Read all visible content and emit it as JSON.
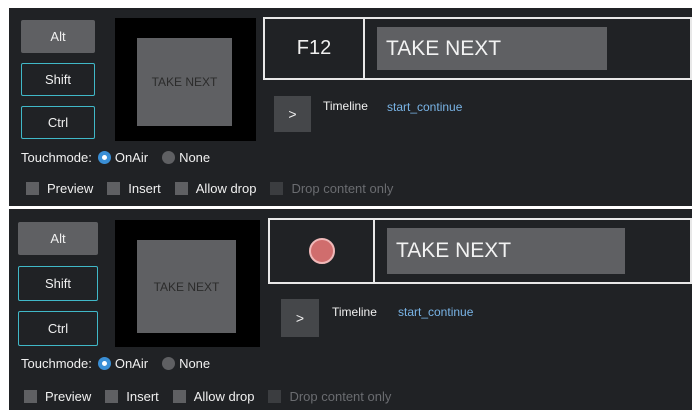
{
  "panels": [
    {
      "modifiers": {
        "alt": "Alt",
        "shift": "Shift",
        "ctrl": "Ctrl"
      },
      "thumbnail_label": "TAKE NEXT",
      "key_label": "F12",
      "button_text": "TAKE NEXT",
      "go_button": ">",
      "timeline_label": "Timeline",
      "timeline_value": "start_continue",
      "touchmode_label": "Touchmode:",
      "touchmode_options": [
        "OnAir",
        "None"
      ],
      "touchmode_selected": "OnAir",
      "checkboxes": [
        "Preview",
        "Insert",
        "Allow drop",
        "Drop content only"
      ]
    },
    {
      "modifiers": {
        "alt": "Alt",
        "shift": "Shift",
        "ctrl": "Ctrl"
      },
      "thumbnail_label": "TAKE NEXT",
      "key_icon": "record-dot-icon",
      "button_text": "TAKE NEXT",
      "go_button": ">",
      "timeline_label": "Timeline",
      "timeline_value": "start_continue",
      "touchmode_label": "Touchmode:",
      "touchmode_options": [
        "OnAir",
        "None"
      ],
      "touchmode_selected": "OnAir",
      "checkboxes": [
        "Preview",
        "Insert",
        "Allow drop",
        "Drop content only"
      ]
    }
  ],
  "colors": {
    "panel_bg": "#202225",
    "accent": "#40b8c8",
    "link": "#79b4e6",
    "record": "#d06d6d"
  }
}
